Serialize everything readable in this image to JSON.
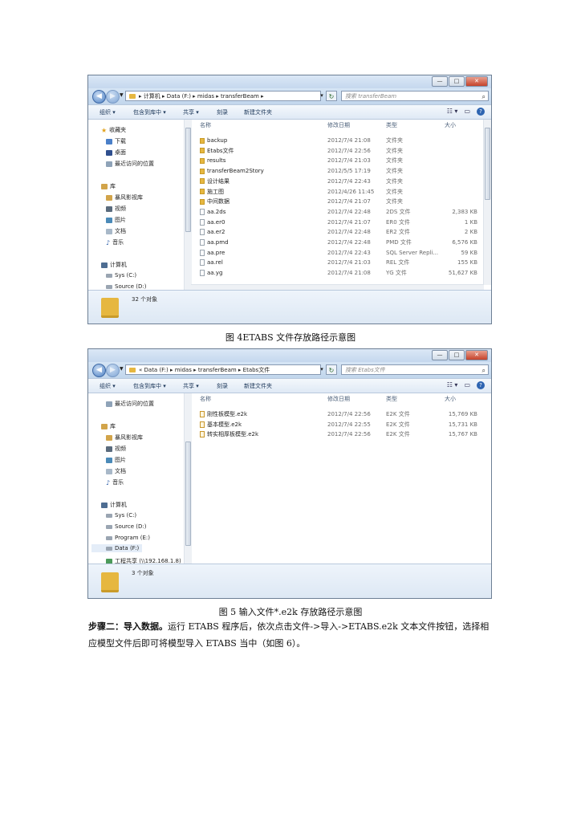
{
  "window1": {
    "address": "▸ 计算机 ▸ Data (F:) ▸ midas ▸ transferBeam ▸",
    "search_placeholder": "搜索 transferBeam",
    "toolbar": {
      "organize": "组织 ▾",
      "include": "包含到库中 ▾",
      "share": "共享 ▾",
      "burn": "刻录",
      "new_folder": "新建文件夹"
    },
    "nav": [
      {
        "label": "收藏夹",
        "icon": "star-icon"
      },
      {
        "label": "下载",
        "icon": "download-icon"
      },
      {
        "label": "桌面",
        "icon": "desktop-icon"
      },
      {
        "label": "最近访问的位置",
        "icon": "recent-icon"
      },
      {
        "label": "库",
        "icon": "library-icon"
      },
      {
        "label": "暴风影视库",
        "icon": "library-icon"
      },
      {
        "label": "视频",
        "icon": "video-icon"
      },
      {
        "label": "图片",
        "icon": "picture-icon"
      },
      {
        "label": "文档",
        "icon": "document-icon"
      },
      {
        "label": "音乐",
        "icon": "music-icon"
      },
      {
        "label": "计算机",
        "icon": "computer-icon"
      },
      {
        "label": "Sys (C:)",
        "icon": "drive-icon"
      },
      {
        "label": "Source (D:)",
        "icon": "drive-icon"
      }
    ],
    "columns": {
      "name": "名称",
      "date": "修改日期",
      "type": "类型",
      "size": "大小"
    },
    "files": [
      {
        "name": "backup",
        "date": "2012/7/4 21:08",
        "type": "文件夹",
        "size": "",
        "kind": "dir"
      },
      {
        "name": "Etabs文件",
        "date": "2012/7/4 22:56",
        "type": "文件夹",
        "size": "",
        "kind": "dir"
      },
      {
        "name": "results",
        "date": "2012/7/4 21:03",
        "type": "文件夹",
        "size": "",
        "kind": "dir"
      },
      {
        "name": "transferBeam2Story",
        "date": "2012/5/5 17:19",
        "type": "文件夹",
        "size": "",
        "kind": "dir"
      },
      {
        "name": "设计结果",
        "date": "2012/7/4 22:43",
        "type": "文件夹",
        "size": "",
        "kind": "dir"
      },
      {
        "name": "施工图",
        "date": "2012/4/26 11:45",
        "type": "文件夹",
        "size": "",
        "kind": "dir"
      },
      {
        "name": "中间数据",
        "date": "2012/7/4 21:07",
        "type": "文件夹",
        "size": "",
        "kind": "dir"
      },
      {
        "name": "aa.2ds",
        "date": "2012/7/4 22:48",
        "type": "2DS 文件",
        "size": "2,383 KB",
        "kind": "file"
      },
      {
        "name": "aa.er0",
        "date": "2012/7/4 21:07",
        "type": "ER0 文件",
        "size": "1 KB",
        "kind": "file"
      },
      {
        "name": "aa.er2",
        "date": "2012/7/4 22:48",
        "type": "ER2 文件",
        "size": "2 KB",
        "kind": "file"
      },
      {
        "name": "aa.pmd",
        "date": "2012/7/4 22:48",
        "type": "PMD 文件",
        "size": "6,576 KB",
        "kind": "file"
      },
      {
        "name": "aa.pre",
        "date": "2012/7/4 22:43",
        "type": "SQL Server Repli...",
        "size": "59 KB",
        "kind": "file"
      },
      {
        "name": "aa.rel",
        "date": "2012/7/4 21:03",
        "type": "REL 文件",
        "size": "155 KB",
        "kind": "file"
      },
      {
        "name": "aa.yg",
        "date": "2012/7/4 21:08",
        "type": "YG 文件",
        "size": "51,627 KB",
        "kind": "file"
      }
    ],
    "status": "32 个对象"
  },
  "caption1": "图 4ETABS 文件存放路径示意图",
  "window2": {
    "address": "« Data (F:) ▸ midas ▸ transferBeam ▸ Etabs文件",
    "search_placeholder": "搜索 Etabs文件",
    "toolbar": {
      "organize": "组织 ▾",
      "include": "包含到库中 ▾",
      "share": "共享 ▾",
      "burn": "刻录",
      "new_folder": "新建文件夹"
    },
    "nav": [
      {
        "label": "最近访问的位置",
        "icon": "recent-icon"
      },
      {
        "label": "库",
        "icon": "library-icon"
      },
      {
        "label": "暴风影视库",
        "icon": "library-icon"
      },
      {
        "label": "视频",
        "icon": "video-icon"
      },
      {
        "label": "图片",
        "icon": "picture-icon"
      },
      {
        "label": "文档",
        "icon": "document-icon"
      },
      {
        "label": "音乐",
        "icon": "music-icon"
      },
      {
        "label": "计算机",
        "icon": "computer-icon"
      },
      {
        "label": "Sys (C:)",
        "icon": "drive-icon"
      },
      {
        "label": "Source (D:)",
        "icon": "drive-icon"
      },
      {
        "label": "Program (E:)",
        "icon": "drive-icon"
      },
      {
        "label": "Data (F:)",
        "icon": "drive-icon"
      },
      {
        "label": "工程共享 (\\\\192.168.1.8)",
        "icon": "network-drive-icon"
      }
    ],
    "columns": {
      "name": "名称",
      "date": "修改日期",
      "type": "类型",
      "size": "大小"
    },
    "files": [
      {
        "name": "刚性板模型.e2k",
        "date": "2012/7/4 22:56",
        "type": "E2K 文件",
        "size": "15,769 KB",
        "kind": "e2k"
      },
      {
        "name": "基本模型.e2k",
        "date": "2012/7/4 22:55",
        "type": "E2K 文件",
        "size": "15,731 KB",
        "kind": "e2k"
      },
      {
        "name": "转实相厚板模型.e2k",
        "date": "2012/7/4 22:56",
        "type": "E2K 文件",
        "size": "15,767 KB",
        "kind": "e2k"
      }
    ],
    "status": "3 个对象"
  },
  "caption2": "图 5 输入文件*.e2k 存放路径示意图",
  "paragraph": {
    "heading": "步骤二：导入数据。",
    "body": "运行 ETABS 程序后，依次点击文件->导入->ETABS.e2k 文本文件按钮，选择相应模型文件后即可将模型导入 ETABS 当中（如图 6）。"
  }
}
